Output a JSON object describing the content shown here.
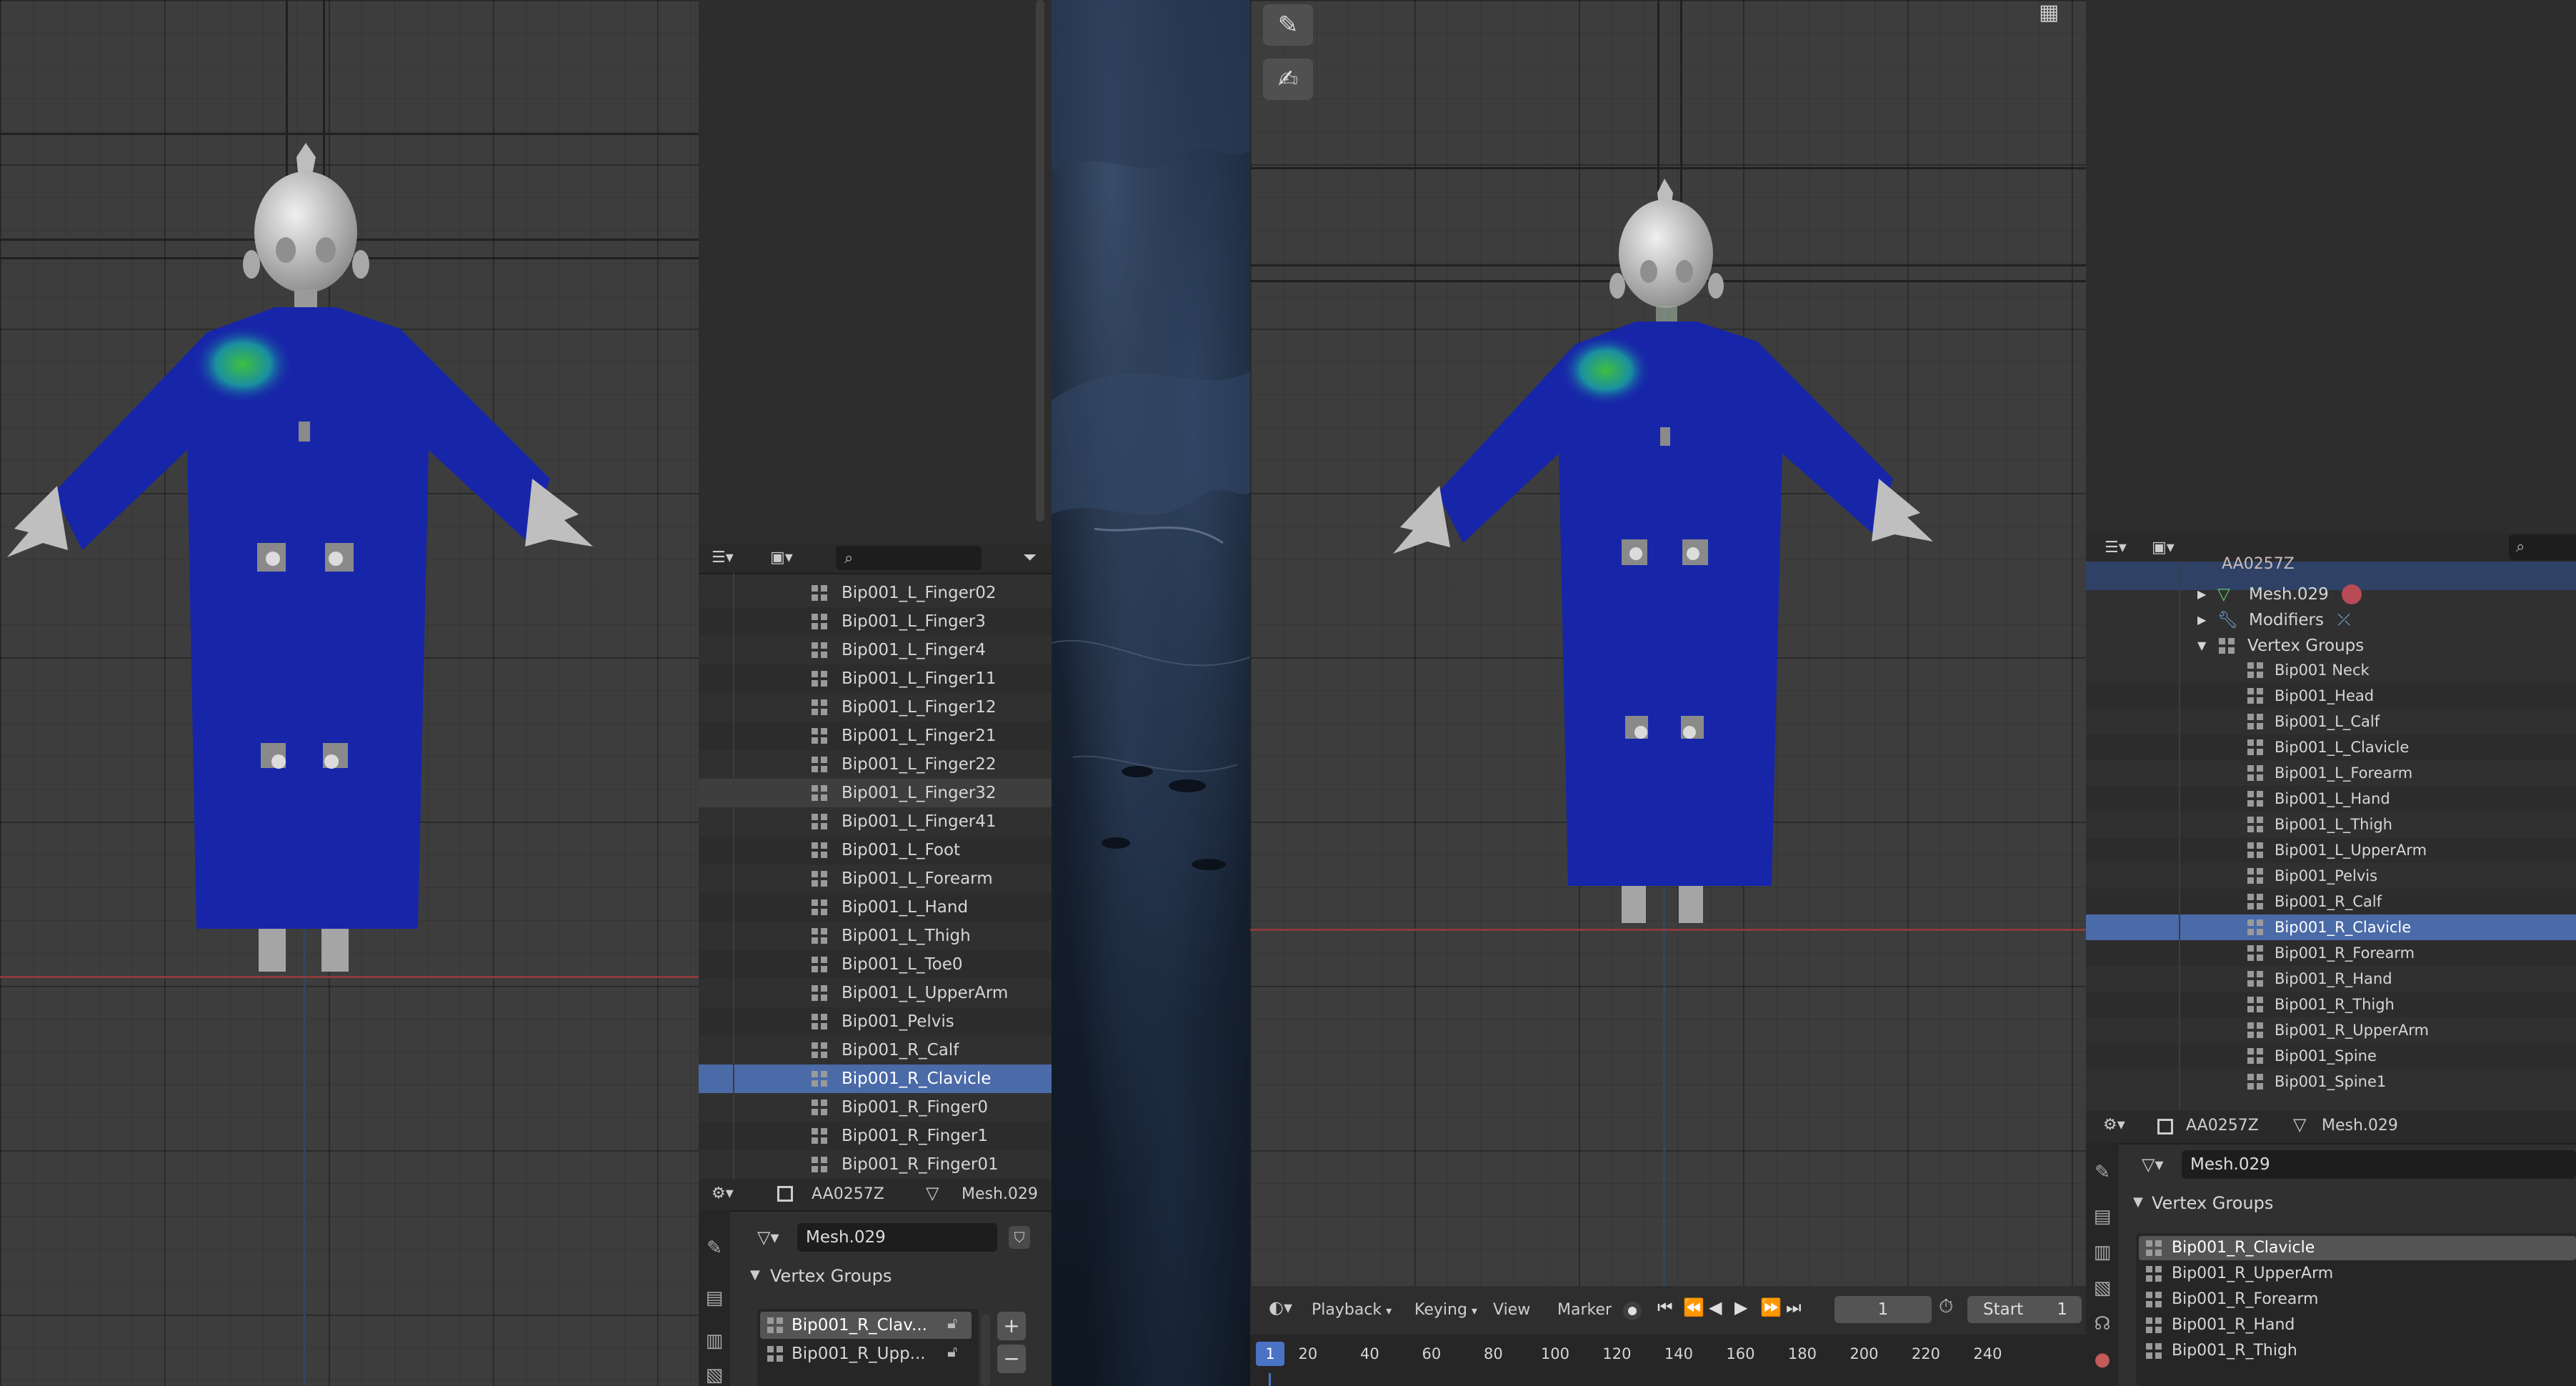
{
  "left_outliner": {
    "items": [
      "Bip001_L_Finger02",
      "Bip001_L_Finger3",
      "Bip001_L_Finger4",
      "Bip001_L_Finger11",
      "Bip001_L_Finger12",
      "Bip001_L_Finger21",
      "Bip001_L_Finger22",
      "Bip001_L_Finger32",
      "Bip001_L_Finger41",
      "Bip001_L_Foot",
      "Bip001_L_Forearm",
      "Bip001_L_Hand",
      "Bip001_L_Thigh",
      "Bip001_L_Toe0",
      "Bip001_L_UpperArm",
      "Bip001_Pelvis",
      "Bip001_R_Calf",
      "Bip001_R_Clavicle",
      "Bip001_R_Finger0",
      "Bip001_R_Finger1",
      "Bip001_R_Finger01"
    ],
    "selected": "Bip001_R_Clavicle",
    "hovered": "Bip001_L_Finger32"
  },
  "left_properties": {
    "object_name": "AA0257Z",
    "mesh_name": "Mesh.029",
    "mesh_field": "Mesh.029",
    "section_title": "Vertex Groups",
    "groups": [
      "Bip001_R_Clav...",
      "Bip001_R_Upp..."
    ],
    "plus": "+",
    "minus": "−"
  },
  "right_outliner": {
    "top_partial": "AA0257Z",
    "mesh": "Mesh.029",
    "modifiers": "Modifiers",
    "vertex_groups": "Vertex Groups",
    "items": [
      "Bip001 Neck",
      "Bip001_Head",
      "Bip001_L_Calf",
      "Bip001_L_Clavicle",
      "Bip001_L_Forearm",
      "Bip001_L_Hand",
      "Bip001_L_Thigh",
      "Bip001_L_UpperArm",
      "Bip001_Pelvis",
      "Bip001_R_Calf",
      "Bip001_R_Clavicle",
      "Bip001_R_Forearm",
      "Bip001_R_Hand",
      "Bip001_R_Thigh",
      "Bip001_R_UpperArm",
      "Bip001_Spine",
      "Bip001_Spine1"
    ],
    "selected": "Bip001_R_Clavicle"
  },
  "right_properties": {
    "object_name": "AA0257Z",
    "mesh_name": "Mesh.029",
    "mesh_field": "Mesh.029",
    "section_title": "Vertex Groups",
    "groups": [
      "Bip001_R_Clavicle",
      "Bip001_R_UpperArm",
      "Bip001_R_Forearm",
      "Bip001_R_Hand",
      "Bip001_R_Thigh"
    ]
  },
  "timeline": {
    "menus": [
      "Playback",
      "Keying",
      "View",
      "Marker"
    ],
    "current_frame": "1",
    "start_label": "Start",
    "start_value": "1",
    "ruler": [
      "1",
      "20",
      "40",
      "60",
      "80",
      "100",
      "120",
      "140",
      "160",
      "180",
      "200",
      "220",
      "240"
    ]
  },
  "colors": {
    "selection": "#4a6aa8",
    "robe": "#1726a8",
    "accent_grid": "#3d3d3d"
  }
}
